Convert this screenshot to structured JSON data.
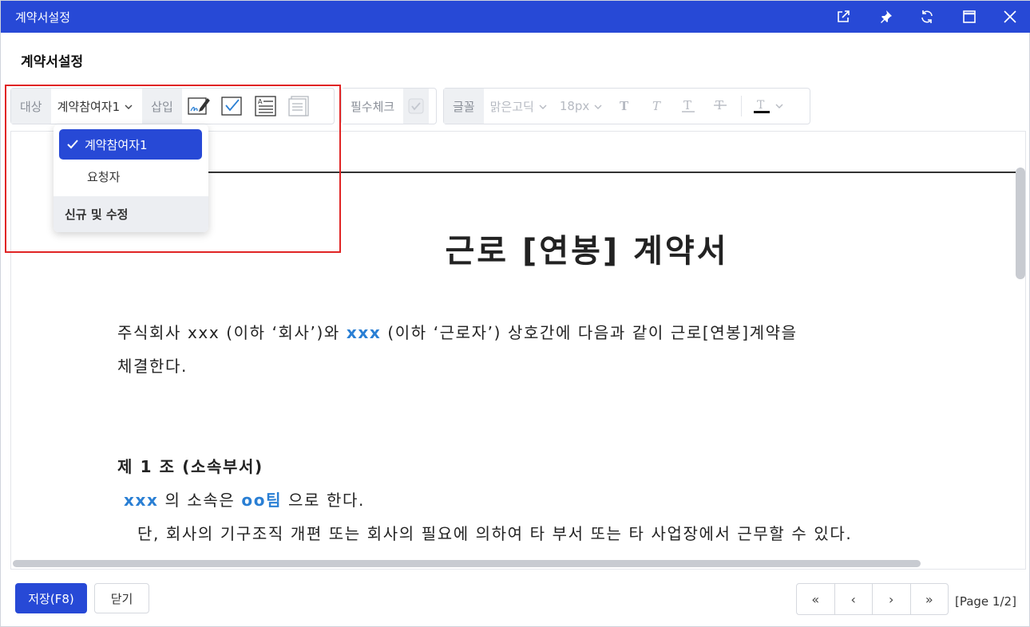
{
  "window": {
    "title": "계약서설정",
    "controls": [
      "external-link",
      "pin",
      "refresh",
      "maximize",
      "close"
    ]
  },
  "heading": "계약서설정",
  "toolbar": {
    "target_label": "대상",
    "target_value": "계약참여자1",
    "insert_label": "삽입",
    "required_label": "필수체크",
    "font_label": "글꼴",
    "font_family_value": "맑은고딕",
    "font_size_value": "18px"
  },
  "dropdown": {
    "options": [
      {
        "label": "계약참여자1",
        "selected": true
      },
      {
        "label": "요청자",
        "selected": false
      }
    ],
    "footer_label": "신규 및 수정"
  },
  "document": {
    "title": "근로 [연봉] 계약서",
    "para1_line1_a": "주식회사 xxx (이하 ‘회사’)와 ",
    "para1_line1_var": "xxx",
    "para1_line1_b": " (이하 ‘근로자’) 상호간에 다음과 같이 근로[연봉]계약을",
    "para1_line2": "체결한다.",
    "article1_title": "제 1 조 (소속부서)",
    "article1_var1": "xxx",
    "article1_mid": " 의 소속은 ",
    "article1_var2": "oo팀",
    "article1_end": " 으로 한다.",
    "article1_line2": "단, 회사의 기구조직 개편 또는 회사의 필요에 의하여 타 부서 또는 타 사업장에서 근무할 수 있다."
  },
  "footer": {
    "save_label": "저장(F8)",
    "close_label": "닫기",
    "pager": [
      "«",
      "‹",
      "›",
      "»"
    ],
    "page_indicator": "[Page 1/2]"
  },
  "colors": {
    "primary": "#2749d6",
    "highlight": "#e02424",
    "variable_text": "#2a7fd4"
  }
}
